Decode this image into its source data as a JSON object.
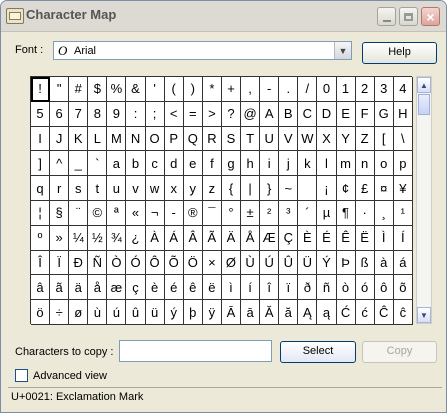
{
  "window": {
    "title": "Character Map"
  },
  "font": {
    "label": "Font :",
    "value": "Arial",
    "icon": "opentype-font-icon"
  },
  "help_label": "Help",
  "characters": [
    "!",
    "\"",
    "#",
    "$",
    "%",
    "&",
    "'",
    "(",
    ")",
    "*",
    "+",
    ",",
    "-",
    ".",
    "/",
    "0",
    "1",
    "2",
    "3",
    "4",
    "5",
    "6",
    "7",
    "8",
    "9",
    ":",
    ";",
    "<",
    "=",
    ">",
    "?",
    "@",
    "A",
    "B",
    "C",
    "D",
    "E",
    "F",
    "G",
    "H",
    "I",
    "J",
    "K",
    "L",
    "M",
    "N",
    "O",
    "P",
    "Q",
    "R",
    "S",
    "T",
    "U",
    "V",
    "W",
    "X",
    "Y",
    "Z",
    "[",
    "\\",
    "]",
    "^",
    "_",
    "`",
    "a",
    "b",
    "c",
    "d",
    "e",
    "f",
    "g",
    "h",
    "i",
    "j",
    "k",
    "l",
    "m",
    "n",
    "o",
    "p",
    "q",
    "r",
    "s",
    "t",
    "u",
    "v",
    "w",
    "x",
    "y",
    "z",
    "{",
    "|",
    "}",
    "~",
    "",
    "¡",
    "¢",
    "£",
    "¤",
    "¥",
    "¦",
    "§",
    "¨",
    "©",
    "ª",
    "«",
    "¬",
    "-",
    "®",
    "¯",
    "°",
    "±",
    "²",
    "³",
    "´",
    "µ",
    "¶",
    "·",
    "¸",
    "¹",
    "º",
    "»",
    "¼",
    "½",
    "¾",
    "¿",
    "À",
    "Á",
    "Â",
    "Ã",
    "Ä",
    "Å",
    "Æ",
    "Ç",
    "È",
    "É",
    "Ê",
    "Ë",
    "Ì",
    "Í",
    "Î",
    "Ï",
    "Ð",
    "Ñ",
    "Ò",
    "Ó",
    "Ô",
    "Õ",
    "Ö",
    "×",
    "Ø",
    "Ù",
    "Ú",
    "Û",
    "Ü",
    "Ý",
    "Þ",
    "ß",
    "à",
    "á",
    "â",
    "ã",
    "ä",
    "å",
    "æ",
    "ç",
    "è",
    "é",
    "ê",
    "ë",
    "ì",
    "í",
    "î",
    "ï",
    "ð",
    "ñ",
    "ò",
    "ó",
    "ô",
    "õ",
    "ö",
    "÷",
    "ø",
    "ù",
    "ú",
    "û",
    "ü",
    "ý",
    "þ",
    "ÿ",
    "Ā",
    "ā",
    "Ă",
    "ă",
    "Ą",
    "ą",
    "Ć",
    "ć",
    "Ĉ",
    "ĉ"
  ],
  "copy": {
    "label": "Characters to copy :",
    "value": ""
  },
  "buttons": {
    "select": "Select",
    "copy": "Copy"
  },
  "advanced_view": "Advanced view",
  "status": "U+0021: Exclamation Mark"
}
